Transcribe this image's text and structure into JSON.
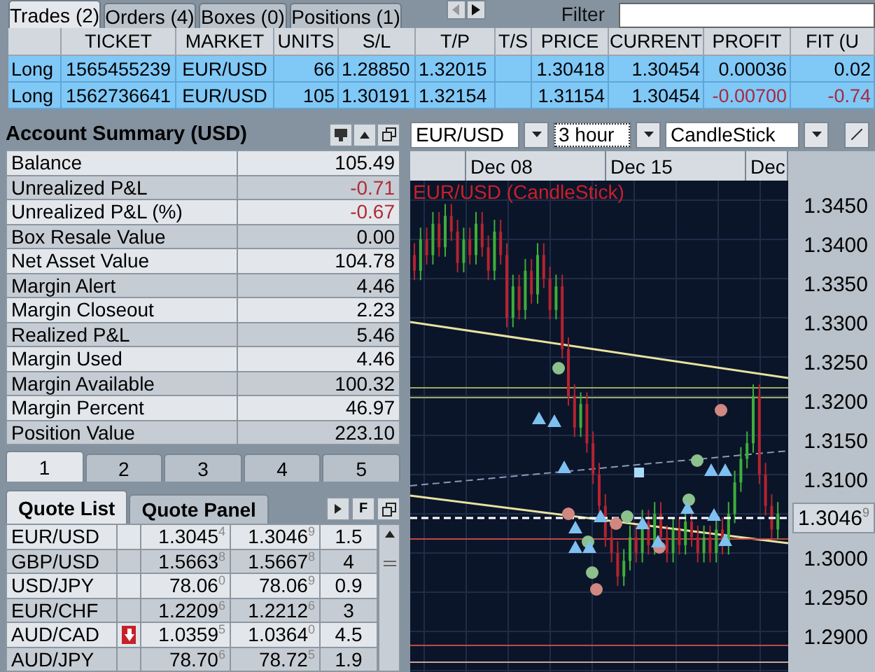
{
  "trade_tabs": [
    {
      "label": "Trades (2)",
      "selected": true
    },
    {
      "label": "Orders (4)",
      "selected": false
    },
    {
      "label": "Boxes (0)",
      "selected": false
    },
    {
      "label": "Positions (1)",
      "selected": false
    }
  ],
  "filter": {
    "label": "Filter"
  },
  "trades": {
    "columns": [
      "",
      "TICKET",
      "MARKET",
      "UNITS",
      "S/L",
      "T/P",
      "T/S",
      "PRICE",
      "CURRENT",
      "PROFIT",
      "FIT (U"
    ],
    "rows": [
      {
        "cells": [
          "Long",
          "1565455239",
          "EUR/USD",
          "66",
          "1.28850",
          "1.32015",
          "",
          "1.30418",
          "1.30454",
          "0.00036",
          "0.02"
        ],
        "loss": false,
        "selected": true
      },
      {
        "cells": [
          "Long",
          "1562736641",
          "EUR/USD",
          "105",
          "1.30191",
          "1.32154",
          "",
          "1.31154",
          "1.30454",
          "-0.00700",
          "-0.74"
        ],
        "loss": true,
        "selected": true
      }
    ]
  },
  "account_summary": {
    "title": "Account Summary (USD)",
    "rows": [
      {
        "label": "Balance",
        "value": "105.49",
        "negative": false
      },
      {
        "label": "Unrealized P&L",
        "value": "-0.71",
        "negative": true
      },
      {
        "label": "Unrealized P&L (%)",
        "value": "-0.67",
        "negative": true
      },
      {
        "label": "Box Resale Value",
        "value": "0.00",
        "negative": false
      },
      {
        "label": "Net Asset Value",
        "value": "104.78",
        "negative": false
      },
      {
        "label": "Margin Alert",
        "value": "4.46",
        "negative": false
      },
      {
        "label": "Margin Closeout",
        "value": "2.23",
        "negative": false
      },
      {
        "label": "Realized P&L",
        "value": "5.46",
        "negative": false
      },
      {
        "label": "Margin Used",
        "value": "4.46",
        "negative": false
      },
      {
        "label": "Margin Available",
        "value": "100.32",
        "negative": false
      },
      {
        "label": "Margin Percent",
        "value": "46.97",
        "negative": false
      },
      {
        "label": "Position Value",
        "value": "223.10",
        "negative": false
      }
    ]
  },
  "page_tabs": [
    {
      "label": "1",
      "selected": true
    },
    {
      "label": "2",
      "selected": false
    },
    {
      "label": "3",
      "selected": false
    },
    {
      "label": "4",
      "selected": false
    },
    {
      "label": "5",
      "selected": false
    }
  ],
  "quote_tabs": [
    {
      "label": "Quote List",
      "selected": true
    },
    {
      "label": "Quote Panel",
      "selected": false
    }
  ],
  "quote_buttons": {
    "filter": "F"
  },
  "quotes": [
    {
      "pair": "EUR/USD",
      "down_arrow": false,
      "bid": "1.3045$^{4}$",
      "ask": "1.3046$^{9}$",
      "spread": "1.5"
    },
    {
      "pair": "GBP/USD",
      "down_arrow": false,
      "bid": "1.5663$^{8}$",
      "ask": "1.5667$^{8}$",
      "spread": "4"
    },
    {
      "pair": "USD/JPY",
      "down_arrow": false,
      "bid": "78.06$^{0}$",
      "ask": "78.06$^{9}$",
      "spread": "0.9"
    },
    {
      "pair": "EUR/CHF",
      "down_arrow": false,
      "bid": "1.2209$^{6}$",
      "ask": "1.2212$^{6}$",
      "spread": "3"
    },
    {
      "pair": "AUD/CAD",
      "down_arrow": true,
      "bid": "1.0359$^{5}$",
      "ask": "1.0364$^{0}$",
      "spread": "4.5"
    },
    {
      "pair": "AUD/JPY",
      "down_arrow": false,
      "bid": "78.70$^{6}$",
      "ask": "78.72$^{5}$",
      "spread": "1.9"
    }
  ],
  "chart": {
    "instrument": "EUR/USD",
    "interval": "3 hour",
    "style": "CandleStick",
    "title": "EUR/USD (CandleStick)",
    "dates": [
      "Dec 08",
      "Dec 15",
      "Dec"
    ],
    "price_ticks": [
      "1.3450",
      "1.3400",
      "1.3350",
      "1.3300",
      "1.3250",
      "1.3200",
      "1.3150",
      "1.3100",
      "1.3000",
      "1.2950",
      "1.2900"
    ],
    "current_price": "1.3046$^{9}$"
  }
}
